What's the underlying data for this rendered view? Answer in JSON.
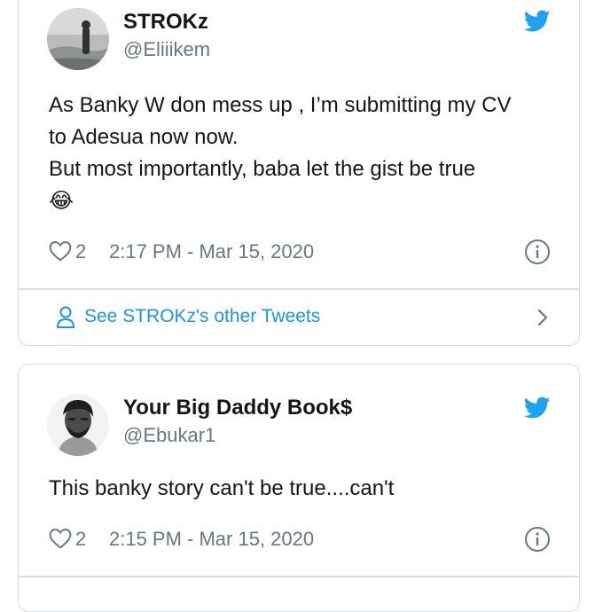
{
  "tweets": [
    {
      "display_name": "STROKz",
      "handle": "@Eliiikem",
      "lines": [
        "As Banky W don mess up , I’m submitting my CV",
        "to Adesua now now.",
        "But most importantly, baba let the gist be true",
        "😂"
      ],
      "likes": "2",
      "timestamp": "2:17 PM - Mar 15, 2020",
      "see_more": "See STROKz's other Tweets"
    },
    {
      "display_name": "Your Big Daddy Book$",
      "handle": "@Ebukar1",
      "lines": [
        "This banky story can't be true....can't"
      ],
      "likes": "2",
      "timestamp": "2:15 PM - Mar 15, 2020"
    }
  ],
  "colors": {
    "twitter_blue": "#1da1f2",
    "link_blue": "#1b95e0",
    "secondary_text": "#657786",
    "border": "#d6dde3"
  },
  "icons": [
    "twitter-bird-icon",
    "heart-icon",
    "info-icon",
    "user-icon",
    "chevron-right-icon"
  ]
}
